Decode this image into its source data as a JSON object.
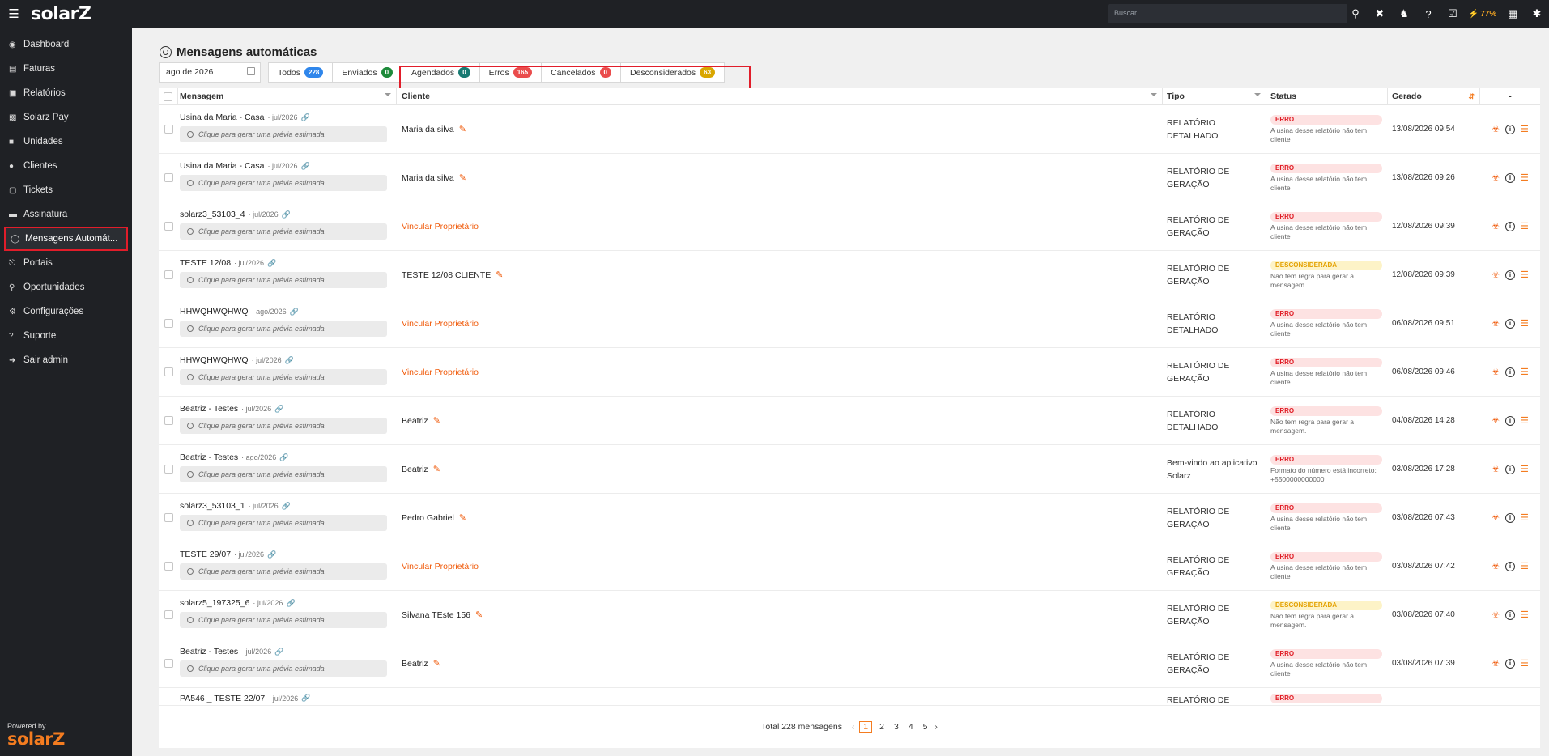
{
  "topbar": {
    "menu_icon": "hamburger-icon",
    "logo": "solarZ",
    "search_placeholder": "Buscar...",
    "battery": "77%"
  },
  "sidebar": {
    "items": [
      {
        "label": "Dashboard",
        "icon": "dashboard-icon"
      },
      {
        "label": "Faturas",
        "icon": "invoice-icon"
      },
      {
        "label": "Relatórios",
        "icon": "report-icon"
      },
      {
        "label": "Solarz Pay",
        "icon": "pay-icon"
      },
      {
        "label": "Unidades",
        "icon": "units-icon"
      },
      {
        "label": "Clientes",
        "icon": "user-icon"
      },
      {
        "label": "Tickets",
        "icon": "ticket-icon"
      },
      {
        "label": "Assinatura",
        "icon": "card-icon"
      },
      {
        "label": "Mensagens Automát...",
        "icon": "whatsapp-icon"
      },
      {
        "label": "Portais",
        "icon": "plug-icon"
      },
      {
        "label": "Oportunidades",
        "icon": "search-icon"
      },
      {
        "label": "Configurações",
        "icon": "gear-icon"
      },
      {
        "label": "Suporte",
        "icon": "help-icon"
      },
      {
        "label": "Sair admin",
        "icon": "logout-icon"
      }
    ],
    "powered_by": "Powered by",
    "powered_logo": "solarZ"
  },
  "page": {
    "title": "Mensagens automáticas",
    "date_filter": "ago de 2026",
    "tabs": [
      {
        "label": "Todos",
        "count": "228",
        "color": "#2f86eb"
      },
      {
        "label": "Enviados",
        "count": "0",
        "color": "#1d8a3a"
      },
      {
        "label": "Agendados",
        "count": "0",
        "color": "#177a72"
      },
      {
        "label": "Erros",
        "count": "165",
        "color": "#ea4c4c"
      },
      {
        "label": "Cancelados",
        "count": "0",
        "color": "#ea4c4c"
      },
      {
        "label": "Desconsiderados",
        "count": "63",
        "color": "#d9a600"
      }
    ]
  },
  "table": {
    "headers": {
      "mensagem": "Mensagem",
      "cliente": "Cliente",
      "tipo": "Tipo",
      "status": "Status",
      "gerado": "Gerado",
      "acoes": "-"
    },
    "preview_text": "Clique para gerar uma prévia estimada",
    "rows": [
      {
        "title": "Usina da Maria - Casa",
        "period": "· jul/2026",
        "client": "Maria da silva",
        "client_link": false,
        "tipo": "RELATÓRIO DETALHADO",
        "status": "ERRO",
        "status_kind": "erro",
        "status_desc": "A usina desse relatório não tem cliente",
        "gerado": "13/08/2026 09:54"
      },
      {
        "title": "Usina da Maria - Casa",
        "period": "· jul/2026",
        "client": "Maria da silva",
        "client_link": false,
        "tipo": "RELATÓRIO DE GERAÇÃO",
        "status": "ERRO",
        "status_kind": "erro",
        "status_desc": "A usina desse relatório não tem cliente",
        "gerado": "13/08/2026 09:26"
      },
      {
        "title": "solarz3_53103_4",
        "period": "· jul/2026",
        "client": "Vincular Proprietário",
        "client_link": true,
        "tipo": "RELATÓRIO DE GERAÇÃO",
        "status": "ERRO",
        "status_kind": "erro",
        "status_desc": "A usina desse relatório não tem cliente",
        "gerado": "12/08/2026 09:39"
      },
      {
        "title": "TESTE 12/08",
        "period": "· jul/2026",
        "client": "TESTE 12/08 CLIENTE",
        "client_link": false,
        "tipo": "RELATÓRIO DE GERAÇÃO",
        "status": "DESCONSIDERADA",
        "status_kind": "desc",
        "status_desc": "Não tem regra para gerar a mensagem.",
        "gerado": "12/08/2026 09:39"
      },
      {
        "title": "HHWQHWQHWQ",
        "period": "· ago/2026",
        "client": "Vincular Proprietário",
        "client_link": true,
        "tipo": "RELATÓRIO DETALHADO",
        "status": "ERRO",
        "status_kind": "erro",
        "status_desc": "A usina desse relatório não tem cliente",
        "gerado": "06/08/2026 09:51"
      },
      {
        "title": "HHWQHWQHWQ",
        "period": "· jul/2026",
        "client": "Vincular Proprietário",
        "client_link": true,
        "tipo": "RELATÓRIO DE GERAÇÃO",
        "status": "ERRO",
        "status_kind": "erro",
        "status_desc": "A usina desse relatório não tem cliente",
        "gerado": "06/08/2026 09:46"
      },
      {
        "title": "Beatriz - Testes",
        "period": "· jul/2026",
        "client": "Beatriz",
        "client_link": false,
        "tipo": "RELATÓRIO DETALHADO",
        "status": "ERRO",
        "status_kind": "erro",
        "status_desc": "Não tem regra para gerar a mensagem.",
        "gerado": "04/08/2026 14:28"
      },
      {
        "title": "Beatriz - Testes",
        "period": "· ago/2026",
        "client": "Beatriz",
        "client_link": false,
        "tipo": "Bem-vindo ao aplicativo Solarz",
        "status": "ERRO",
        "status_kind": "erro",
        "status_desc": "Formato do número está incorreto: +5500000000000",
        "gerado": "03/08/2026 17:28"
      },
      {
        "title": "solarz3_53103_1",
        "period": "· jul/2026",
        "client": "Pedro Gabriel",
        "client_link": false,
        "tipo": "RELATÓRIO DE GERAÇÃO",
        "status": "ERRO",
        "status_kind": "erro",
        "status_desc": "A usina desse relatório não tem cliente",
        "gerado": "03/08/2026 07:43"
      },
      {
        "title": "TESTE 29/07",
        "period": "· jul/2026",
        "client": "Vincular Proprietário",
        "client_link": true,
        "tipo": "RELATÓRIO DE GERAÇÃO",
        "status": "ERRO",
        "status_kind": "erro",
        "status_desc": "A usina desse relatório não tem cliente",
        "gerado": "03/08/2026 07:42"
      },
      {
        "title": "solarz5_197325_6",
        "period": "· jul/2026",
        "client": "Silvana TEste 156",
        "client_link": false,
        "tipo": "RELATÓRIO DE GERAÇÃO",
        "status": "DESCONSIDERADA",
        "status_kind": "desc",
        "status_desc": "Não tem regra para gerar a mensagem.",
        "gerado": "03/08/2026 07:40"
      },
      {
        "title": "Beatriz - Testes",
        "period": "· jul/2026",
        "client": "Beatriz",
        "client_link": false,
        "tipo": "RELATÓRIO DE GERAÇÃO",
        "status": "ERRO",
        "status_kind": "erro",
        "status_desc": "A usina desse relatório não tem cliente",
        "gerado": "03/08/2026 07:39"
      }
    ],
    "partial_row": {
      "title": "PA546 _ TESTE 22/07",
      "period": "· jul/2026",
      "tipo": "RELATÓRIO DE",
      "status": "ERRO"
    }
  },
  "pagination": {
    "total": "Total 228 mensagens",
    "pages": [
      "1",
      "2",
      "3",
      "4",
      "5"
    ],
    "current": "1"
  }
}
